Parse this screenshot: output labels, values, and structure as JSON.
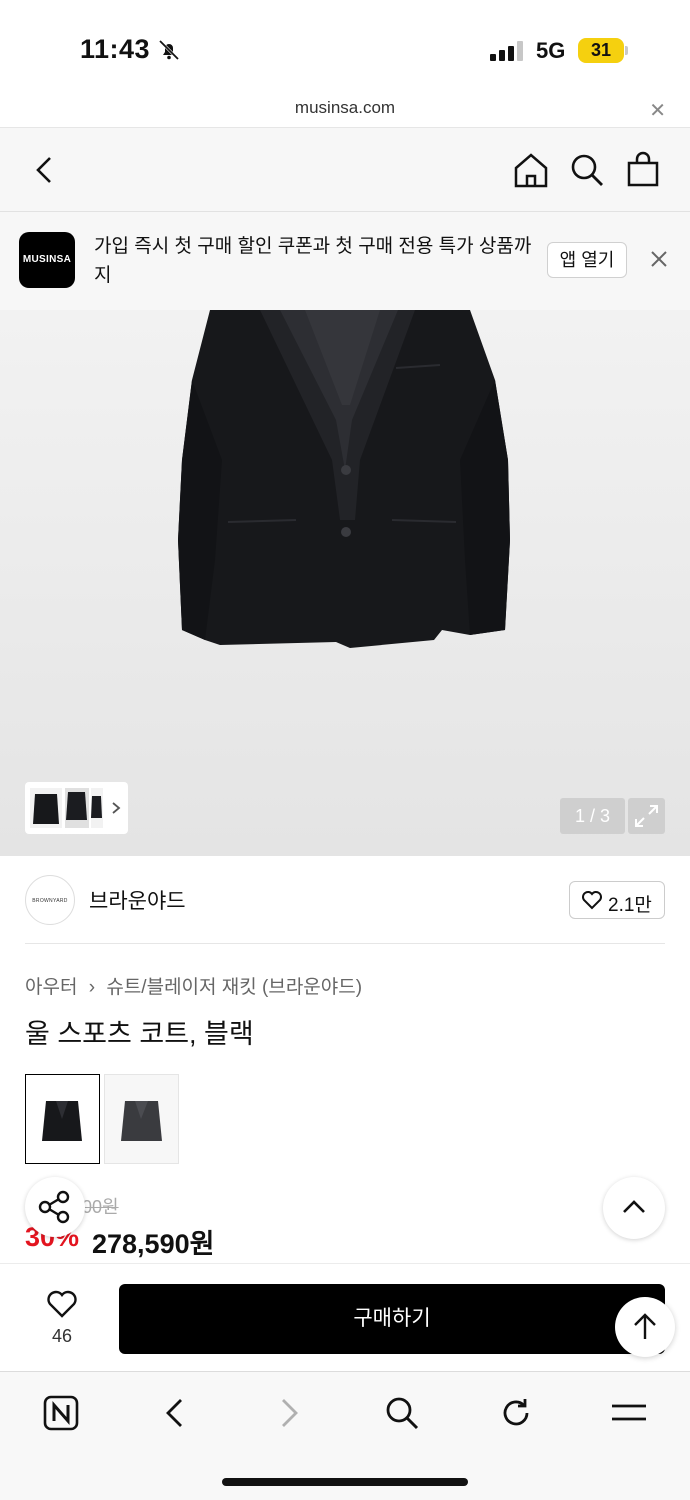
{
  "status": {
    "time": "11:43",
    "network": "5G",
    "battery": "31"
  },
  "browser": {
    "url": "musinsa.com"
  },
  "banner": {
    "logo": "MUSINSA",
    "text": "가입 즉시 첫 구매 할인 쿠폰과 첫 구매 전용 특가 상품까지",
    "open_label": "앱 열기"
  },
  "gallery": {
    "counter": "1 / 3"
  },
  "brand": {
    "logo_text": "BROWNYARD",
    "name": "브라운야드",
    "likes": "2.1만"
  },
  "breadcrumb": {
    "level1": "아우터",
    "level2": "슈트/블레이저 재킷 (브라운야드)"
  },
  "product": {
    "title": "울 스포츠 코트, 블랙",
    "original_price": "00원",
    "discount": "30%",
    "price": "278,590원"
  },
  "purchase": {
    "like_count": "46",
    "buy_label": "구매하기"
  },
  "colors": {
    "accent": "#000000",
    "discount": "#e3141f",
    "battery": "#f5d00f"
  }
}
